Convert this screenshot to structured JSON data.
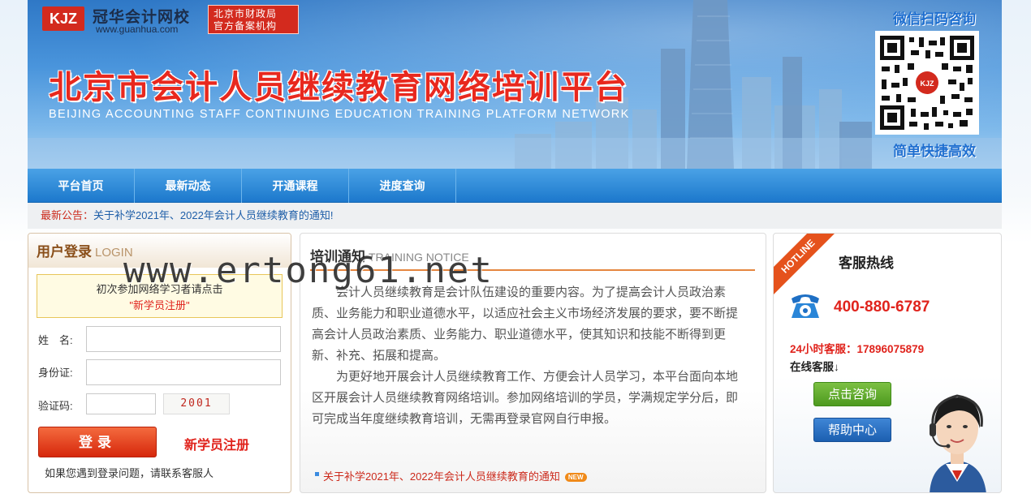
{
  "header": {
    "logo_abbr": "KJZ",
    "logo_name": "冠华会计网校",
    "logo_url": "www.guanhua.com",
    "stamp_line1": "北京市财政局",
    "stamp_line2": "官方备案机构",
    "title": "北京市会计人员继续教育网络培训平台",
    "subtitle": "BEIJING ACCOUNTING STAFF CONTINUING EDUCATION TRAINING PLATFORM NETWORK",
    "qr_top": "微信扫码咨询",
    "qr_bottom": "简单快捷高效"
  },
  "nav": {
    "items": [
      {
        "label": "平台首页"
      },
      {
        "label": "最新动态"
      },
      {
        "label": "开通课程"
      },
      {
        "label": "进度查询"
      }
    ]
  },
  "notice": {
    "label": "最新公告：",
    "text": "关于补学2021年、2022年会计人员继续教育的通知!"
  },
  "login": {
    "title": "用户登录",
    "title_en": "LOGIN",
    "tip_line1": "初次参加网络学习者请点击",
    "tip_line2": "\"新学员注册\"",
    "name_label": "姓　名:",
    "id_label": "身份证:",
    "code_label": "验证码:",
    "captcha": "2001",
    "login_button": "登录",
    "register_link": "新学员注册",
    "help_text": "如果您遇到登录问题，请联系客服人"
  },
  "training": {
    "title": "培训通知",
    "title_en": "TRAINING NOTICE",
    "para1": "会计人员继续教育是会计队伍建设的重要内容。为了提高会计人员政治素质、业务能力和职业道德水平，以适应社会主义市场经济发展的要求，要不断提高会计人员政治素质、业务能力、职业道德水平，使其知识和技能不断得到更新、补充、拓展和提高。",
    "para2": "为更好地开展会计人员继续教育工作、方便会计人员学习，本平台面向本地区开展会计人员继续教育网络培训。参加网络培训的学员，学满规定学分后，即可完成当年度继续教育培训，无需再登录官网自行申报。",
    "link": "关于补学2021年、2022年会计人员继续教育的通知",
    "badge": "NEW"
  },
  "service": {
    "ribbon": "HOTLINE",
    "title": "客服热线",
    "phone": "400-880-6787",
    "hours_line": "24小时客服：17896075879",
    "online_label": "在线客服↓",
    "consult_button": "点击咨询",
    "help_button": "帮助中心"
  },
  "watermark": "www.ertong61.net",
  "colors": {
    "accent_red": "#e0231c",
    "nav_blue": "#1c78cc",
    "brand_blue": "#1f6fd0"
  }
}
